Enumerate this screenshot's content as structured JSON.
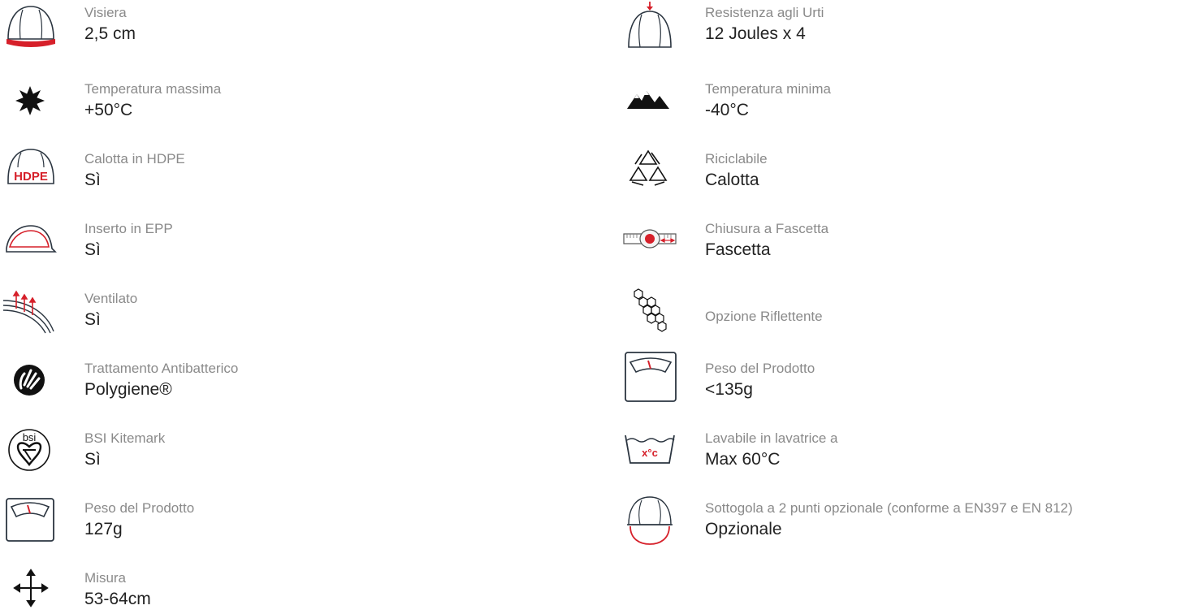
{
  "colors": {
    "accent": "#d6202a",
    "icon_stroke": "#2b3540",
    "label": "#8a8a8a",
    "value": "#222222"
  },
  "left_features": [
    {
      "icon": "helmet-visor-icon",
      "label": "Visiera",
      "value": "2,5 cm"
    },
    {
      "icon": "sun-icon",
      "label": "Temperatura massima",
      "value": "+50°C"
    },
    {
      "icon": "hdpe-helmet-icon",
      "label": "Calotta in HDPE",
      "value": "Sì"
    },
    {
      "icon": "epp-insert-icon",
      "label": "Inserto in EPP",
      "value": "Sì"
    },
    {
      "icon": "ventilation-icon",
      "label": "Ventilato",
      "value": "Sì"
    },
    {
      "icon": "antibacterial-hand-icon",
      "label": "Trattamento Antibatterico",
      "value": "Polygiene®"
    },
    {
      "icon": "bsi-kitemark-icon",
      "label": "BSI Kitemark",
      "value": "Sì"
    },
    {
      "icon": "weight-scale-icon",
      "label": "Peso del Prodotto",
      "value": "127g"
    },
    {
      "icon": "size-arrows-icon",
      "label": "Misura",
      "value": "53-64cm"
    }
  ],
  "right_features": [
    {
      "icon": "impact-resistance-icon",
      "label": "Resistenza agli Urti",
      "value": "12 Joules x 4"
    },
    {
      "icon": "mountains-icon",
      "label": "Temperatura minima",
      "value": "-40°C"
    },
    {
      "icon": "recycle-icon",
      "label": "Riciclabile",
      "value": "Calotta"
    },
    {
      "icon": "strap-closure-icon",
      "label": "Chiusura a Fascetta",
      "value": "Fascetta"
    },
    {
      "icon": "reflective-hexagon-icon",
      "label": "Opzione Riflettente",
      "value": ""
    },
    {
      "icon": "weight-scale-icon",
      "label": "Peso del Prodotto",
      "value": "<135g"
    },
    {
      "icon": "washable-icon",
      "label": "Lavabile in lavatrice a",
      "value": "Max 60°C",
      "icon_text": "x°c"
    },
    {
      "icon": "chinstrap-icon",
      "label": "Sottogola a 2 punti opzionale (conforme a EN397 e EN 812)",
      "value": "Opzionale"
    }
  ],
  "icon_text": {
    "hdpe": "HDPE",
    "bsi": "bsi",
    "wash": "x°c"
  }
}
